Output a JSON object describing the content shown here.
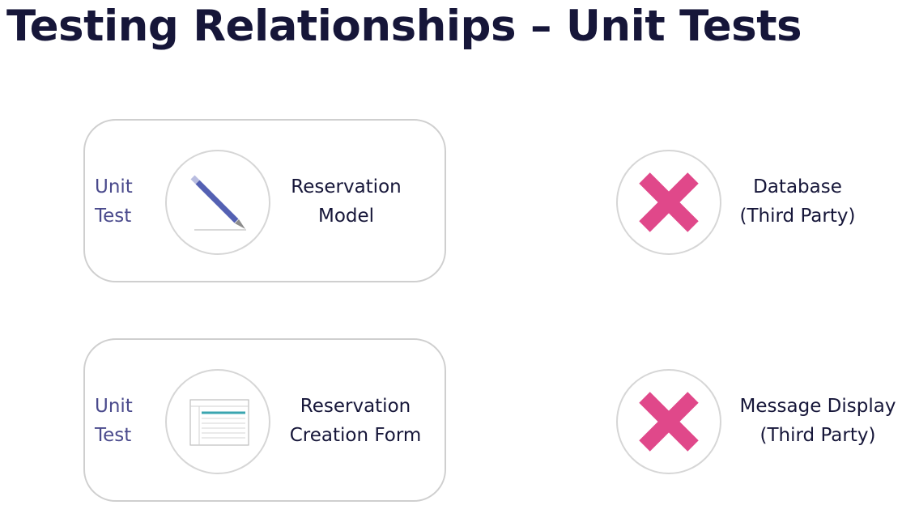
{
  "title": "Testing Relationships – Unit Tests",
  "rows": [
    {
      "tag": [
        "Unit",
        "Test"
      ],
      "component_icon": "pencil-icon",
      "component": [
        "Reservation",
        "Model"
      ],
      "dependency_icon": "cross-icon",
      "dependency": [
        "Database",
        "(Third Party)"
      ]
    },
    {
      "tag": [
        "Unit",
        "Test"
      ],
      "component_icon": "form-window-icon",
      "component": [
        "Reservation",
        "Creation Form"
      ],
      "dependency_icon": "cross-icon",
      "dependency": [
        "Message Display",
        "(Third Party)"
      ]
    }
  ],
  "colors": {
    "title": "#161639",
    "tag": "#4a4a8c",
    "cross": "#e0488a",
    "pencil": "#5461b3",
    "form_accent": "#3aa5b0"
  }
}
